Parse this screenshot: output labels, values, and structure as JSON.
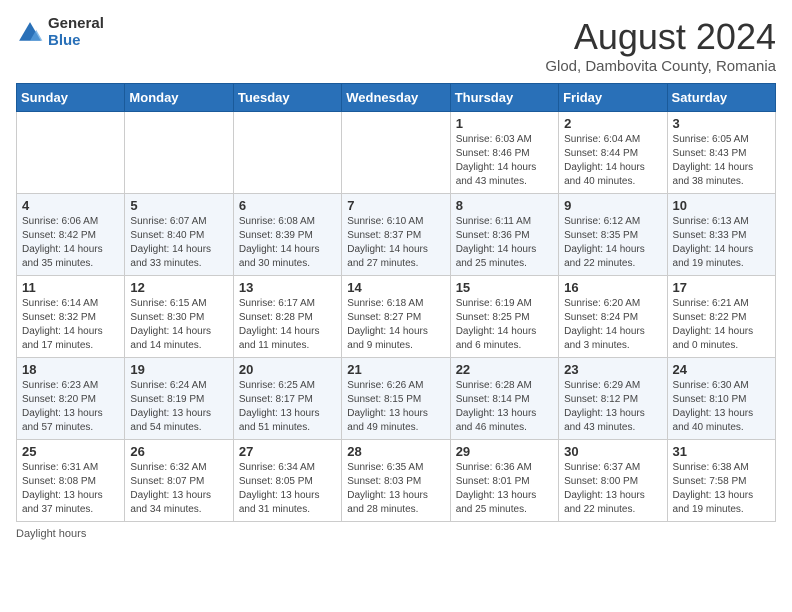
{
  "header": {
    "logo_general": "General",
    "logo_blue": "Blue",
    "main_title": "August 2024",
    "subtitle": "Glod, Dambovita County, Romania"
  },
  "calendar": {
    "days_of_week": [
      "Sunday",
      "Monday",
      "Tuesday",
      "Wednesday",
      "Thursday",
      "Friday",
      "Saturday"
    ],
    "weeks": [
      [
        {
          "day": "",
          "detail": ""
        },
        {
          "day": "",
          "detail": ""
        },
        {
          "day": "",
          "detail": ""
        },
        {
          "day": "",
          "detail": ""
        },
        {
          "day": "1",
          "detail": "Sunrise: 6:03 AM\nSunset: 8:46 PM\nDaylight: 14 hours and 43 minutes."
        },
        {
          "day": "2",
          "detail": "Sunrise: 6:04 AM\nSunset: 8:44 PM\nDaylight: 14 hours and 40 minutes."
        },
        {
          "day": "3",
          "detail": "Sunrise: 6:05 AM\nSunset: 8:43 PM\nDaylight: 14 hours and 38 minutes."
        }
      ],
      [
        {
          "day": "4",
          "detail": "Sunrise: 6:06 AM\nSunset: 8:42 PM\nDaylight: 14 hours and 35 minutes."
        },
        {
          "day": "5",
          "detail": "Sunrise: 6:07 AM\nSunset: 8:40 PM\nDaylight: 14 hours and 33 minutes."
        },
        {
          "day": "6",
          "detail": "Sunrise: 6:08 AM\nSunset: 8:39 PM\nDaylight: 14 hours and 30 minutes."
        },
        {
          "day": "7",
          "detail": "Sunrise: 6:10 AM\nSunset: 8:37 PM\nDaylight: 14 hours and 27 minutes."
        },
        {
          "day": "8",
          "detail": "Sunrise: 6:11 AM\nSunset: 8:36 PM\nDaylight: 14 hours and 25 minutes."
        },
        {
          "day": "9",
          "detail": "Sunrise: 6:12 AM\nSunset: 8:35 PM\nDaylight: 14 hours and 22 minutes."
        },
        {
          "day": "10",
          "detail": "Sunrise: 6:13 AM\nSunset: 8:33 PM\nDaylight: 14 hours and 19 minutes."
        }
      ],
      [
        {
          "day": "11",
          "detail": "Sunrise: 6:14 AM\nSunset: 8:32 PM\nDaylight: 14 hours and 17 minutes."
        },
        {
          "day": "12",
          "detail": "Sunrise: 6:15 AM\nSunset: 8:30 PM\nDaylight: 14 hours and 14 minutes."
        },
        {
          "day": "13",
          "detail": "Sunrise: 6:17 AM\nSunset: 8:28 PM\nDaylight: 14 hours and 11 minutes."
        },
        {
          "day": "14",
          "detail": "Sunrise: 6:18 AM\nSunset: 8:27 PM\nDaylight: 14 hours and 9 minutes."
        },
        {
          "day": "15",
          "detail": "Sunrise: 6:19 AM\nSunset: 8:25 PM\nDaylight: 14 hours and 6 minutes."
        },
        {
          "day": "16",
          "detail": "Sunrise: 6:20 AM\nSunset: 8:24 PM\nDaylight: 14 hours and 3 minutes."
        },
        {
          "day": "17",
          "detail": "Sunrise: 6:21 AM\nSunset: 8:22 PM\nDaylight: 14 hours and 0 minutes."
        }
      ],
      [
        {
          "day": "18",
          "detail": "Sunrise: 6:23 AM\nSunset: 8:20 PM\nDaylight: 13 hours and 57 minutes."
        },
        {
          "day": "19",
          "detail": "Sunrise: 6:24 AM\nSunset: 8:19 PM\nDaylight: 13 hours and 54 minutes."
        },
        {
          "day": "20",
          "detail": "Sunrise: 6:25 AM\nSunset: 8:17 PM\nDaylight: 13 hours and 51 minutes."
        },
        {
          "day": "21",
          "detail": "Sunrise: 6:26 AM\nSunset: 8:15 PM\nDaylight: 13 hours and 49 minutes."
        },
        {
          "day": "22",
          "detail": "Sunrise: 6:28 AM\nSunset: 8:14 PM\nDaylight: 13 hours and 46 minutes."
        },
        {
          "day": "23",
          "detail": "Sunrise: 6:29 AM\nSunset: 8:12 PM\nDaylight: 13 hours and 43 minutes."
        },
        {
          "day": "24",
          "detail": "Sunrise: 6:30 AM\nSunset: 8:10 PM\nDaylight: 13 hours and 40 minutes."
        }
      ],
      [
        {
          "day": "25",
          "detail": "Sunrise: 6:31 AM\nSunset: 8:08 PM\nDaylight: 13 hours and 37 minutes."
        },
        {
          "day": "26",
          "detail": "Sunrise: 6:32 AM\nSunset: 8:07 PM\nDaylight: 13 hours and 34 minutes."
        },
        {
          "day": "27",
          "detail": "Sunrise: 6:34 AM\nSunset: 8:05 PM\nDaylight: 13 hours and 31 minutes."
        },
        {
          "day": "28",
          "detail": "Sunrise: 6:35 AM\nSunset: 8:03 PM\nDaylight: 13 hours and 28 minutes."
        },
        {
          "day": "29",
          "detail": "Sunrise: 6:36 AM\nSunset: 8:01 PM\nDaylight: 13 hours and 25 minutes."
        },
        {
          "day": "30",
          "detail": "Sunrise: 6:37 AM\nSunset: 8:00 PM\nDaylight: 13 hours and 22 minutes."
        },
        {
          "day": "31",
          "detail": "Sunrise: 6:38 AM\nSunset: 7:58 PM\nDaylight: 13 hours and 19 minutes."
        }
      ]
    ]
  },
  "footer": {
    "note": "Daylight hours"
  }
}
